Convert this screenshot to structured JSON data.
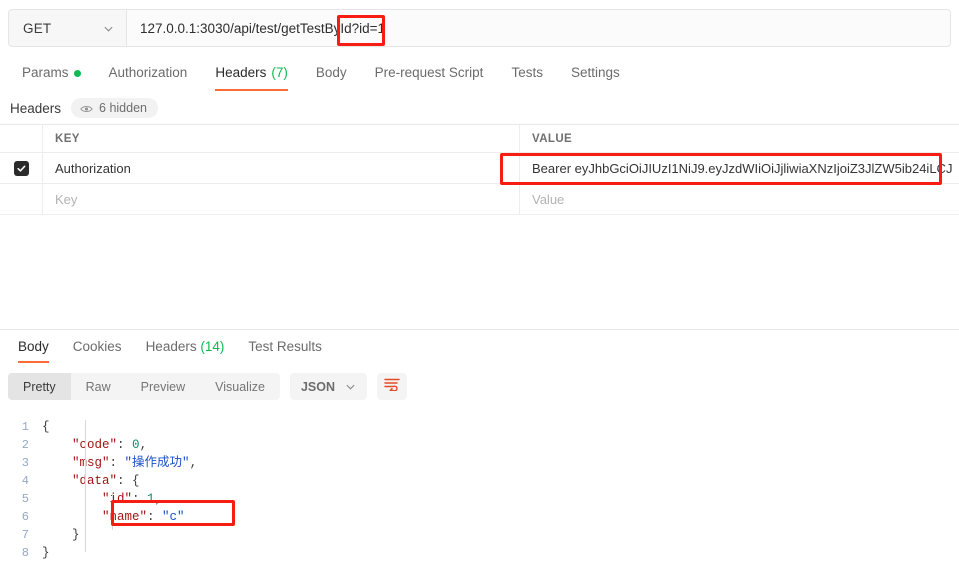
{
  "request": {
    "method": "GET",
    "method_icon": "chevron-down-icon",
    "url": "127.0.0.1:3030/api/test/getTestById?id=1",
    "tabs": [
      {
        "label": "Params",
        "badge": "",
        "dot": true,
        "active": false
      },
      {
        "label": "Authorization",
        "badge": "",
        "dot": false,
        "active": false
      },
      {
        "label": "Headers",
        "badge": "(7)",
        "dot": false,
        "active": true
      },
      {
        "label": "Body",
        "badge": "",
        "dot": false,
        "active": false
      },
      {
        "label": "Pre-request Script",
        "badge": "",
        "dot": false,
        "active": false
      },
      {
        "label": "Tests",
        "badge": "",
        "dot": false,
        "active": false
      },
      {
        "label": "Settings",
        "badge": "",
        "dot": false,
        "active": false
      }
    ]
  },
  "headers_panel": {
    "title": "Headers",
    "hidden_pill": "6 hidden",
    "hidden_icon": "eye-icon",
    "columns": {
      "key": "KEY",
      "value": "VALUE"
    },
    "rows": [
      {
        "checked": true,
        "key": "Authorization",
        "value": "Bearer eyJhbGciOiJIUzI1NiJ9.eyJzdWIiOiJjliwiaXNzIjoiZ3JlZW5ib24iLCJ"
      }
    ],
    "placeholder_row": {
      "key": "Key",
      "value": "Value"
    }
  },
  "response": {
    "tabs": [
      {
        "label": "Body",
        "badge": "",
        "active": true
      },
      {
        "label": "Cookies",
        "badge": "",
        "active": false
      },
      {
        "label": "Headers",
        "badge": "(14)",
        "active": false
      },
      {
        "label": "Test Results",
        "badge": "",
        "active": false
      }
    ],
    "view_modes": [
      {
        "label": "Pretty",
        "active": true
      },
      {
        "label": "Raw",
        "active": false
      },
      {
        "label": "Preview",
        "active": false
      },
      {
        "label": "Visualize",
        "active": false
      }
    ],
    "format": "JSON",
    "format_icon": "chevron-down-icon",
    "wrap_icon": "wrap-lines-icon",
    "body_lines": [
      {
        "n": "1",
        "text": "{"
      },
      {
        "n": "2",
        "text": "    \"code\": 0,"
      },
      {
        "n": "3",
        "text": "    \"msg\": \"操作成功\","
      },
      {
        "n": "4",
        "text": "    \"data\": {"
      },
      {
        "n": "5",
        "text": "        \"id\": 1,"
      },
      {
        "n": "6",
        "text": "        \"name\": \"c\""
      },
      {
        "n": "7",
        "text": "    }"
      },
      {
        "n": "8",
        "text": "}"
      }
    ]
  },
  "annotations": {
    "accent_red": "#f81d12",
    "query_param": "id=1",
    "token_value": "Bearer eyJhbGciOiJIUzI1NiJ9.eyJzdWIiOiJjliwiaXNzIjoiZ3JlZW5ib24iLCJ",
    "json_name_line": "\"name\": \"c\""
  },
  "colors": {
    "accent_orange": "#ff6c37",
    "badge_green": "#0cbb52"
  }
}
